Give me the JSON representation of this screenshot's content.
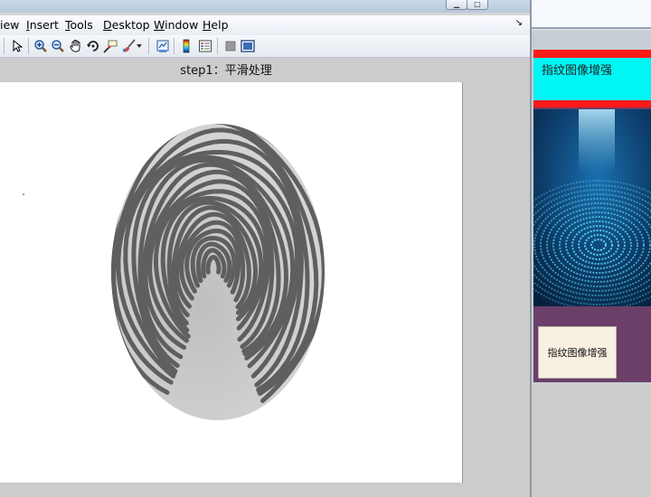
{
  "figure_window": {
    "menu": [
      {
        "pre": "",
        "ul": "",
        "post": "iew"
      },
      {
        "pre": "",
        "ul": "I",
        "post": "nsert"
      },
      {
        "pre": "",
        "ul": "T",
        "post": "ools"
      },
      {
        "pre": "",
        "ul": "D",
        "post": "esktop"
      },
      {
        "pre": "",
        "ul": "W",
        "post": "indow"
      },
      {
        "pre": "",
        "ul": "H",
        "post": "elp"
      }
    ],
    "menu_collapse": "↘",
    "toolbar_icons": [
      "edit-plot-arrow-icon",
      "zoom-in-icon",
      "zoom-out-icon",
      "pan-hand-icon",
      "rotate-3d-icon",
      "data-cursor-icon",
      "brush-icon",
      "brush-dropdown-icon",
      "link-plot-icon",
      "colorbar-icon",
      "legend-icon",
      "hide-plot-tools-icon",
      "show-plot-tools-icon"
    ],
    "axes_title": "step1：平滑处理",
    "image_content": "fingerprint"
  },
  "gui_window": {
    "title": "指纹图像增强",
    "button_label": "指纹图像增强",
    "image_content": "glowing-blue-fingerprint",
    "colors": {
      "panel": "#6b3f68",
      "title_bar": "#00f5f5",
      "stripe": "#ff1a1a",
      "button": "#f8f1e3"
    }
  }
}
